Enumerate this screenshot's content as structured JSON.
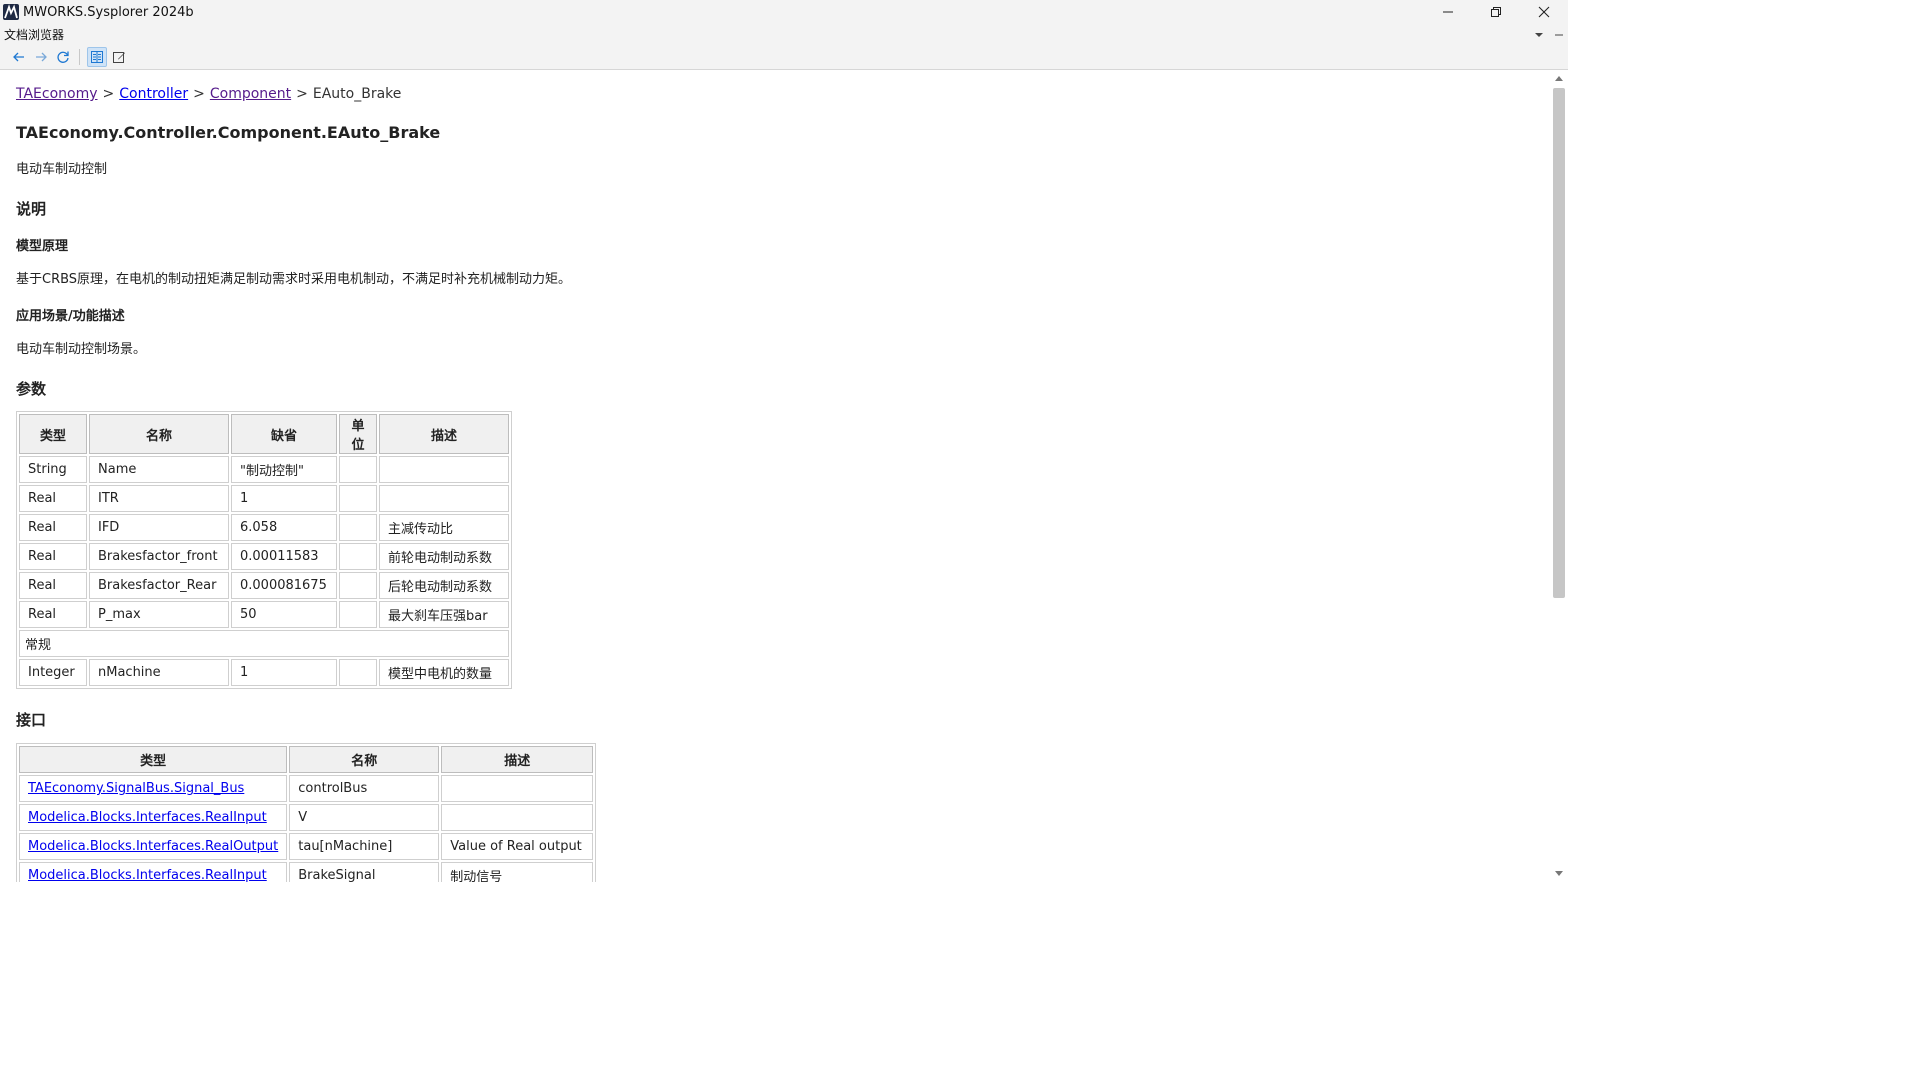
{
  "window": {
    "title": "MWORKS.Sysplorer 2024b"
  },
  "panel": {
    "title": "文档浏览器"
  },
  "breadcrumb": {
    "items": [
      "TAEconomy",
      "Controller",
      "Component"
    ],
    "separator": ">",
    "current": "EAuto_Brake"
  },
  "doc": {
    "title": "TAEconomy.Controller.Component.EAuto_Brake",
    "summary": "电动车制动控制",
    "description_heading": "说明",
    "principle_heading": "模型原理",
    "principle_text": "基于CRBS原理，在电机的制动扭矩满足制动需求时采用电机制动，不满足时补充机械制动力矩。",
    "usage_heading": "应用场景/功能描述",
    "usage_text": "电动车制动控制场景。",
    "params_heading": "参数",
    "ports_heading": "接口"
  },
  "params": {
    "headers": [
      "类型",
      "名称",
      "缺省",
      "单位",
      "描述"
    ],
    "rows": [
      [
        "String",
        "Name",
        "\"制动控制\"",
        "",
        ""
      ],
      [
        "Real",
        "ITR",
        "1",
        "",
        ""
      ],
      [
        "Real",
        "IFD",
        "6.058",
        "",
        "主减传动比"
      ],
      [
        "Real",
        "Brakesfactor_front",
        "0.00011583",
        "",
        "前轮电动制动系数"
      ],
      [
        "Real",
        "Brakesfactor_Rear",
        "0.000081675",
        "",
        "后轮电动制动系数"
      ],
      [
        "Real",
        "P_max",
        "50",
        "",
        "最大刹车压强bar"
      ]
    ],
    "group_label": "常规",
    "group_rows": [
      [
        "Integer",
        "nMachine",
        "1",
        "",
        "模型中电机的数量"
      ]
    ]
  },
  "ports": {
    "headers": [
      "类型",
      "名称",
      "描述"
    ],
    "rows": [
      [
        "TAEconomy.SignalBus.Signal_Bus",
        "controlBus",
        ""
      ],
      [
        "Modelica.Blocks.Interfaces.RealInput",
        "V",
        ""
      ],
      [
        "Modelica.Blocks.Interfaces.RealOutput",
        "tau[nMachine]",
        "Value of Real output"
      ],
      [
        "Modelica.Blocks.Interfaces.RealInput",
        "BrakeSignal",
        "制动信号"
      ]
    ]
  },
  "colors": {
    "link": "#0000ee",
    "visited_link": "#551a8b",
    "chrome": "#f3f3f3",
    "toolbar_icon": "#1e78d2"
  },
  "icons": {
    "back": "arrow-left-icon",
    "forward": "arrow-right-icon",
    "refresh": "refresh-icon",
    "doc_view": "document-view-icon",
    "edit": "edit-icon"
  }
}
